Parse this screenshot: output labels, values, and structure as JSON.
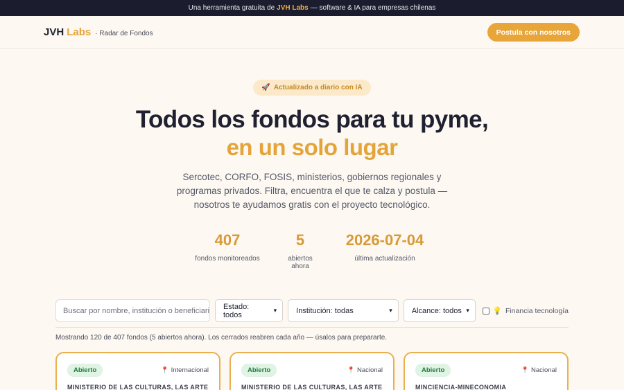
{
  "topbar": {
    "prefix": "Una herramienta gratuita de",
    "brand": "JVH Labs",
    "suffix": "— software & IA para empresas chilenas"
  },
  "header": {
    "logo_main": "JVH",
    "logo_accent": "Labs",
    "subtitle": "· Radar de Fondos",
    "cta_label": "Postula con nosotros"
  },
  "hero": {
    "pill_icon": "🚀",
    "pill_text": "Actualizado a diario con IA",
    "title_line1": "Todos los fondos para tu pyme,",
    "title_line2": "en un solo lugar",
    "description": "Sercotec, CORFO, FOSIS, ministerios, gobiernos regionales y programas privados. Filtra, encuentra el que te calza y postula — nosotros te ayudamos gratis con el proyecto tecnológico."
  },
  "stats": [
    {
      "value": "407",
      "label": "fondos monitoreados"
    },
    {
      "value": "5",
      "label": "abiertos ahora"
    },
    {
      "value": "2026-07-04",
      "label": "última actualización"
    }
  ],
  "filters": {
    "search_placeholder": "Buscar por nombre, institución o beneficiario",
    "estado": "Estado: todos",
    "institucion": "Institución: todas",
    "alcance": "Alcance: todos",
    "tech_icon": "💡",
    "tech_label": "Financia tecnología"
  },
  "results_text": "Mostrando 120 de 407 fondos (5 abiertos ahora). Los cerrados reabren cada año — úsalos para prepararte.",
  "cards": [
    {
      "status": "Abierto",
      "scope": "Internacional",
      "institution": "MINISTERIO DE LAS CULTURAS, LAS ARTES Y"
    },
    {
      "status": "Abierto",
      "scope": "Nacional",
      "institution": "MINISTERIO DE LAS CULTURAS, LAS ARTES Y"
    },
    {
      "status": "Abierto",
      "scope": "Nacional",
      "institution": "MINCIENCIA-MINECONOMIA"
    }
  ],
  "colors": {
    "accent": "#e8a63a",
    "topbar_bg": "#1b1d2e",
    "page_bg": "#fdf8f1",
    "open_badge_bg": "#dff4e4",
    "open_badge_text": "#1f7a3b"
  }
}
